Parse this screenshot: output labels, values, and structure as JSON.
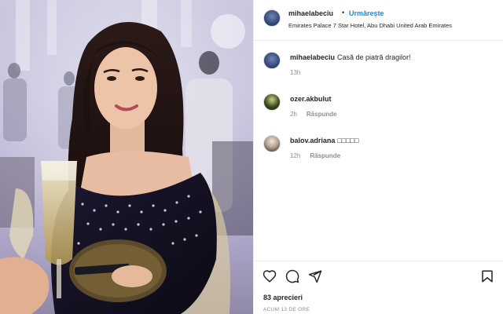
{
  "post": {
    "username": "mihaelabeciu",
    "separator": "•",
    "follow_label": "Urmărește",
    "location": "Emirates Palace 7 Star Hotel, Abu Dhabi United Arab Emirates"
  },
  "comments": [
    {
      "username": "mihaelabeciu",
      "text": "Casă de piatră dragilor!",
      "time": "13h",
      "reply_label": ""
    },
    {
      "username": "ozer.akbulut",
      "text": "",
      "time": "2h",
      "reply_label": "Răspunde"
    },
    {
      "username": "balov.adriana",
      "text": "□□□□□",
      "time": "12h",
      "reply_label": "Răspunde"
    }
  ],
  "footer": {
    "likes": "83 aprecieri",
    "time": "ACUM 13 DE ORE"
  },
  "icons": {
    "like": "heart-icon",
    "comment": "comment-icon",
    "share": "share-icon",
    "save": "bookmark-icon"
  },
  "colors": {
    "accent": "#0095f6",
    "text": "#262626",
    "muted": "#8e8e8e"
  }
}
